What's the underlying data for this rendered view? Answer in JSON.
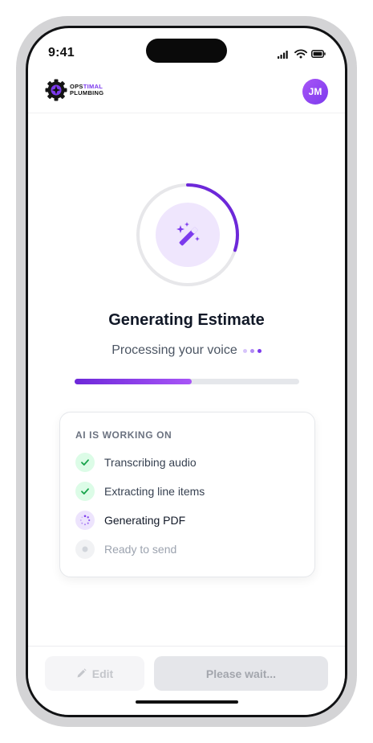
{
  "status_bar": {
    "time": "9:41"
  },
  "header": {
    "logo_line1_a": "OPS",
    "logo_line1_b": "TIMAL",
    "logo_line2": "PLUMBING",
    "avatar_initials": "JM"
  },
  "progress_ring": {
    "icon": "magic-wand-icon",
    "fraction": 0.3
  },
  "main": {
    "title": "Generating Estimate",
    "subtitle": "Processing your voice",
    "progress_fraction": 0.52
  },
  "task_card": {
    "title": "AI IS WORKING ON",
    "tasks": [
      {
        "label": "Transcribing audio",
        "status": "done"
      },
      {
        "label": "Extracting line items",
        "status": "done"
      },
      {
        "label": "Generating PDF",
        "status": "in-progress"
      },
      {
        "label": "Ready to send",
        "status": "pending"
      }
    ]
  },
  "footer": {
    "edit_label": "Edit",
    "wait_label": "Please wait..."
  },
  "colors": {
    "accent": "#7c3aed",
    "accent_light": "#a855f7",
    "success": "#16a34a"
  }
}
